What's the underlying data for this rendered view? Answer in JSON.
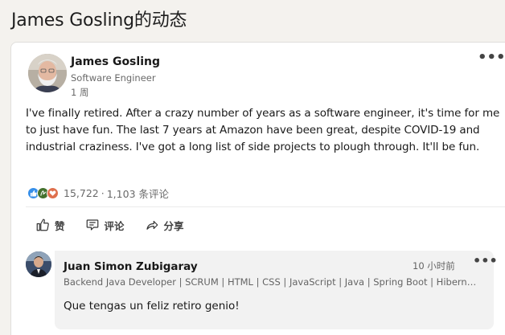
{
  "page": {
    "title": "James Gosling的动态"
  },
  "post": {
    "author": {
      "name": "James Gosling",
      "headline": "Software Engineer",
      "time": "1 周",
      "avatar_icon": "gray-bearded-man-photo"
    },
    "menu_label": "•••",
    "body": "I've finally retired.  After a crazy number of years as a software engineer, it's time for me to just have fun.  The last 7 years at Amazon have been great, despite COVID-19 and industrial craziness.  I've got a long list of side projects to plough through.  It'll be fun.",
    "reactions": {
      "icons": [
        "like-icon",
        "celebrate-icon",
        "love-icon"
      ],
      "reaction_count": "15,722",
      "separator": "·",
      "comment_count": "1,103 条评论"
    },
    "actions": [
      {
        "label": "赞",
        "icon": "thumbs-up-icon"
      },
      {
        "label": "评论",
        "icon": "comment-icon"
      },
      {
        "label": "分享",
        "icon": "share-arrow-icon"
      }
    ]
  },
  "comment": {
    "author": "Juan Simon Zubigaray",
    "time": "10 小时前",
    "menu_label": "•••",
    "headline": "Backend Java Developer | SCRUM | HTML | CSS | JavaScript | Java | Spring Boot | Hibernate",
    "text": "Que tengas un feliz retiro genio!"
  },
  "colors": {
    "background": "#f4f2ee",
    "card": "#ffffff",
    "like_blue": "#378fe9",
    "celebrate_green": "#44712e",
    "love_red": "#df704d"
  }
}
